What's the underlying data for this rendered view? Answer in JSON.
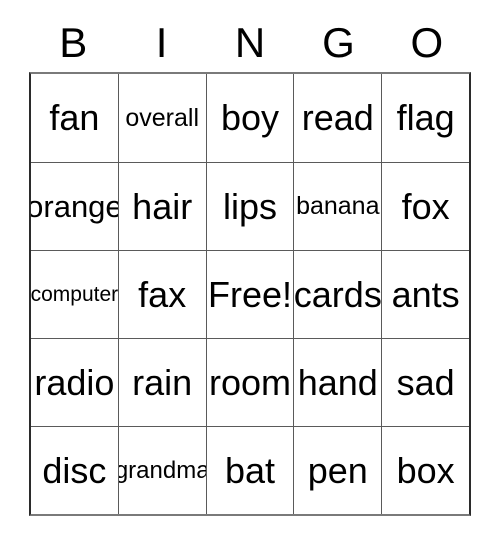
{
  "card": {
    "header": {
      "letters": [
        "B",
        "I",
        "N",
        "G",
        "O"
      ]
    },
    "colors": {
      "text": "#000000",
      "background": "#ffffff",
      "grid_line": "#5a5a5a",
      "outer_border": "#2b2b2b"
    },
    "free_space": "Free!",
    "rows": [
      [
        {
          "text": "fan",
          "size": "normal"
        },
        {
          "text": "overall",
          "size": "small"
        },
        {
          "text": "boy",
          "size": "normal"
        },
        {
          "text": "read",
          "size": "normal"
        },
        {
          "text": "flag",
          "size": "normal"
        }
      ],
      [
        {
          "text": "orange",
          "size": "medium"
        },
        {
          "text": "hair",
          "size": "normal"
        },
        {
          "text": "lips",
          "size": "normal"
        },
        {
          "text": "banana",
          "size": "small"
        },
        {
          "text": "fox",
          "size": "normal"
        }
      ],
      [
        {
          "text": "computer",
          "size": "tiny"
        },
        {
          "text": "fax",
          "size": "normal"
        },
        {
          "text": "Free!",
          "size": "normal"
        },
        {
          "text": "cards",
          "size": "normal"
        },
        {
          "text": "ants",
          "size": "normal"
        }
      ],
      [
        {
          "text": "radio",
          "size": "normal"
        },
        {
          "text": "rain",
          "size": "normal"
        },
        {
          "text": "room",
          "size": "normal"
        },
        {
          "text": "hand",
          "size": "normal"
        },
        {
          "text": "sad",
          "size": "normal"
        }
      ],
      [
        {
          "text": "disc",
          "size": "normal"
        },
        {
          "text": "grandma",
          "size": "small"
        },
        {
          "text": "bat",
          "size": "normal"
        },
        {
          "text": "pen",
          "size": "normal"
        },
        {
          "text": "box",
          "size": "normal"
        }
      ]
    ]
  }
}
